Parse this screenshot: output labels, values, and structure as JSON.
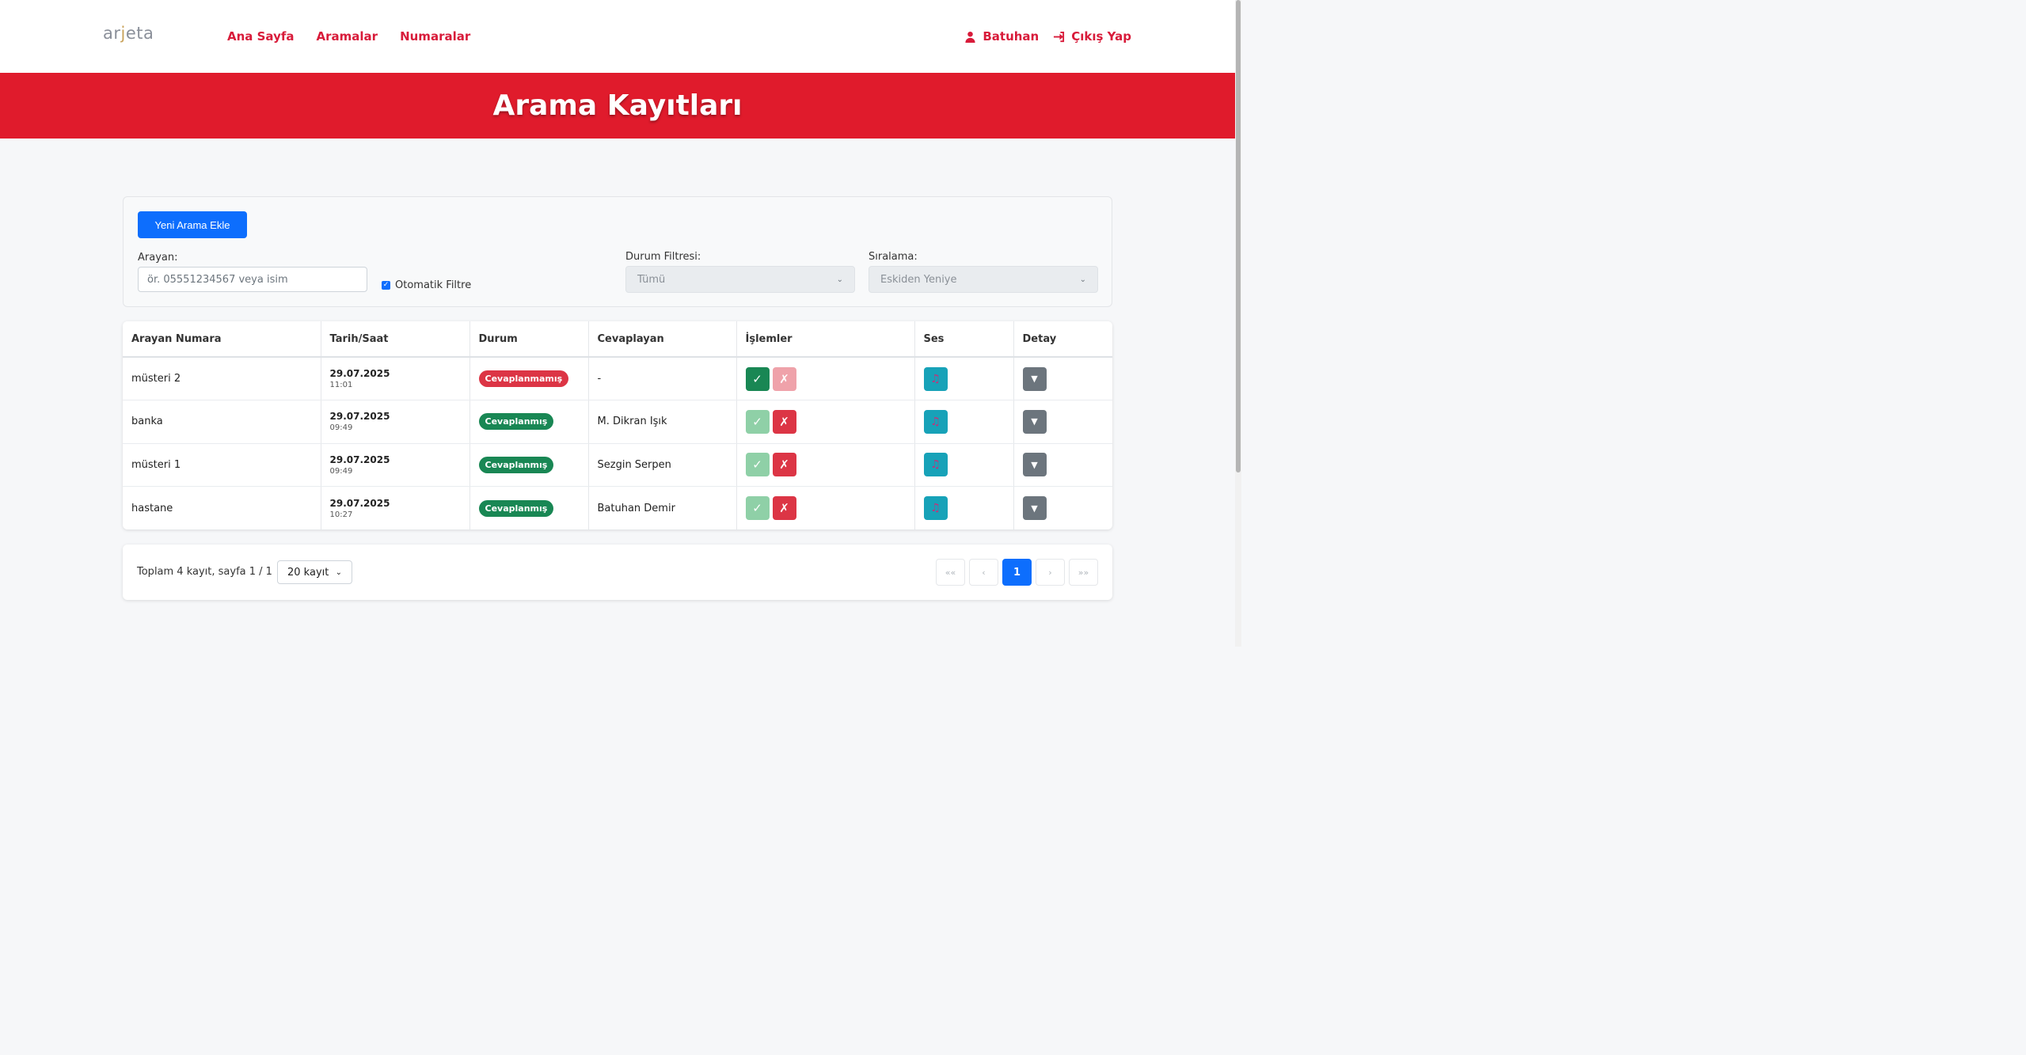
{
  "app": {
    "logo": {
      "pre": "ar",
      "j": "j",
      "post": "eta"
    },
    "nav": {
      "home": "Ana Sayfa",
      "calls": "Aramalar",
      "numbers": "Numaralar"
    },
    "user": {
      "name": "Batuhan",
      "logout": "Çıkış Yap"
    }
  },
  "hero": {
    "title": "Arama Kayıtları"
  },
  "filters": {
    "new_call_button": "Yeni Arama Ekle",
    "caller_label": "Arayan:",
    "caller_placeholder": "ör. 05551234567 veya isim",
    "auto_filter_label": "Otomatik Filtre",
    "auto_filter_checked": true,
    "status_label": "Durum Filtresi:",
    "status_value": "Tümü",
    "sort_label": "Sıralama:",
    "sort_value": "Eskiden Yeniye"
  },
  "table": {
    "headers": {
      "caller": "Arayan Numara",
      "datetime": "Tarih/Saat",
      "status": "Durum",
      "answerer": "Cevaplayan",
      "actions": "İşlemler",
      "audio": "Ses",
      "detail": "Detay"
    },
    "rows": [
      {
        "caller": "müsteri 2",
        "date": "29.07.2025",
        "time": "11:01",
        "status": "Cevaplanmamış",
        "status_type": "unanswered",
        "answerer": "-"
      },
      {
        "caller": "banka",
        "date": "29.07.2025",
        "time": "09:49",
        "status": "Cevaplanmış",
        "status_type": "answered",
        "answerer": "M. Dikran Işık"
      },
      {
        "caller": "müsteri 1",
        "date": "29.07.2025",
        "time": "09:49",
        "status": "Cevaplanmış",
        "status_type": "answered",
        "answerer": "Sezgin Serpen"
      },
      {
        "caller": "hastane",
        "date": "29.07.2025",
        "time": "10:27",
        "status": "Cevaplanmış",
        "status_type": "answered",
        "answerer": "Batuhan Demir"
      }
    ],
    "icons": {
      "approve": "check-icon",
      "reject": "x-icon",
      "audio": "music-note-icon",
      "detail": "caret-down-icon"
    }
  },
  "pagination": {
    "summary": "Toplam 4 kayıt, sayfa 1 / 1",
    "per_page": "20 kayıt",
    "first": "««",
    "prev": "‹",
    "current": "1",
    "next": "›",
    "last": "»»"
  },
  "colors": {
    "brand_red": "#e01b2c",
    "nav_red": "#d81b3a",
    "primary_blue": "#0d6efd",
    "success": "#198754",
    "danger": "#dc3545",
    "info": "#17a2b8",
    "secondary": "#6c757d"
  }
}
